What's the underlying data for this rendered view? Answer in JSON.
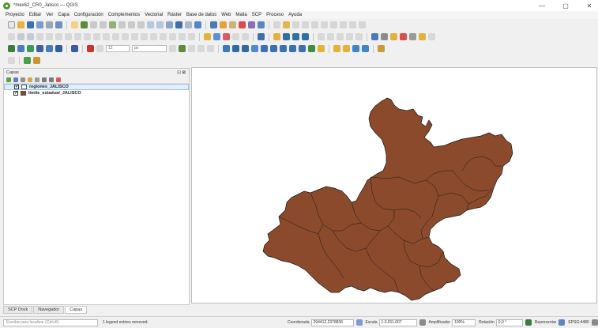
{
  "window": {
    "title": "*mex62_CR0_Jalisco — QGIS",
    "controls": [
      "—",
      "▢",
      "✕"
    ]
  },
  "menu": [
    "Proyecto",
    "Editar",
    "Ver",
    "Capa",
    "Configuración",
    "Complementos",
    "Vectorial",
    "Ráster",
    "Base de datos",
    "Web",
    "Malla",
    "SCP",
    "Proceso",
    "Ayuda"
  ],
  "toolbar": {
    "font_size_value": "12",
    "unit_value": "px"
  },
  "layers_panel": {
    "title": "Capas",
    "header_controls": "⊡ ⊠",
    "layers": [
      {
        "name": "regiones_JALISCO",
        "checked": "✓",
        "swatch": "#ffffff"
      },
      {
        "name": "limite_estadual_JALISCO",
        "checked": "✓",
        "swatch": "#8b4a2b"
      }
    ]
  },
  "bottom_tabs": [
    "SCP Dock",
    "Navegador",
    "Capas"
  ],
  "statusbar": {
    "locator_placeholder": "Escriba para localizar (Ctrl+K)",
    "message": "1 legend entries removed.",
    "coordinate_label": "Coordenada",
    "coordinate_value": "294412,2378836",
    "scale_label": "Escala",
    "scale_value": "1:3.811.007",
    "magnifier_label": "Amplificador",
    "magnifier_value": "100%",
    "rotation_label": "Rotación",
    "rotation_value": "0,0 °",
    "render_label": "Representar",
    "crs_label": "EPSG:4486"
  },
  "colors": {
    "fill": "#8b4a2b",
    "stroke": "#1a1a1a"
  }
}
